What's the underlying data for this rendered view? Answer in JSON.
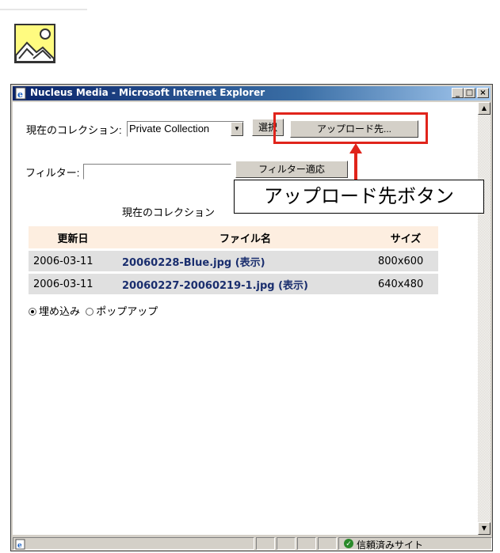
{
  "window": {
    "title": "Nucleus Media - Microsoft Internet Explorer",
    "controls": {
      "minimize": "_",
      "maximize": "□",
      "close": "×"
    }
  },
  "collection": {
    "label": "現在のコレクション:",
    "selected": "Private Collection",
    "select_button": "選択",
    "upload_button": "アップロード先..."
  },
  "filter": {
    "label": "フィルター:",
    "value": "",
    "apply_button": "フィルター適応"
  },
  "current_collection_caption": "現在のコレクション",
  "table": {
    "headers": [
      "更新日",
      "ファイル名",
      "サイズ"
    ],
    "rows": [
      {
        "date": "2006-03-11",
        "filename": "20060228-Blue.jpg (表示)",
        "size": "800x600"
      },
      {
        "date": "2006-03-11",
        "filename": "20060227-20060219-1.jpg (表示)",
        "size": "640x480"
      }
    ]
  },
  "insert_mode": {
    "options": [
      "埋め込み",
      "ポップアップ"
    ],
    "selected": "埋め込み"
  },
  "statusbar": {
    "zone": "信頼済みサイト"
  },
  "annotation": {
    "callout": "アップロード先ボタン",
    "color": "#e0241b"
  },
  "icons": [
    "image-insert-icon",
    "ie-page-icon",
    "dropdown-arrow-icon",
    "scroll-up-arrow-icon",
    "scroll-down-arrow-icon",
    "trusted-site-check-icon"
  ]
}
